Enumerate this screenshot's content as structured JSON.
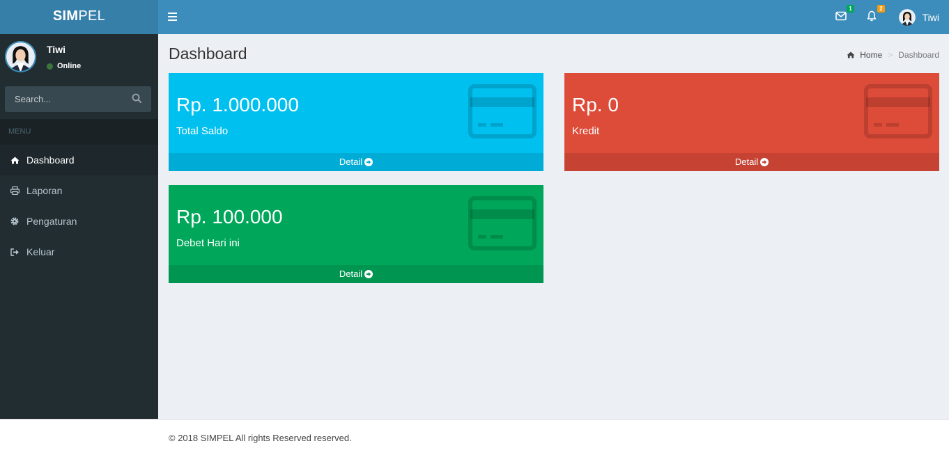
{
  "app": {
    "logo_bold": "SIM",
    "logo_rest": "PEL"
  },
  "header": {
    "messages_count": "1",
    "notifications_count": "2",
    "user_name": "Tiwi"
  },
  "sidebar": {
    "user_name": "Tiwi",
    "status": "Online",
    "search_placeholder": "Search...",
    "menu_header": "MENU",
    "items": [
      {
        "label": "Dashboard",
        "icon": "home-icon",
        "active": true
      },
      {
        "label": "Laporan",
        "icon": "print-icon",
        "active": false
      },
      {
        "label": "Pengaturan",
        "icon": "gear-icon",
        "active": false
      },
      {
        "label": "Keluar",
        "icon": "sign-out-icon",
        "active": false
      }
    ]
  },
  "main": {
    "title": "Dashboard",
    "breadcrumb": {
      "home": "Home",
      "current": "Dashboard"
    },
    "boxes": [
      {
        "amount": "Rp. 1.000.000",
        "label": "Total Saldo",
        "link": "Detail",
        "color": "#00c0ef"
      },
      {
        "amount": "Rp. 0",
        "label": "Kredit",
        "link": "Detail",
        "color": "#dd4b39"
      },
      {
        "amount": "Rp. 100.000",
        "label": "Debet Hari ini",
        "link": "Detail",
        "color": "#00a65a"
      }
    ]
  },
  "footer": {
    "text": "© 2018 SIMPEL All rights Reserved reserved."
  },
  "colors": {
    "header": "#3c8dbc",
    "logo_bg": "#367fa9",
    "sidebar": "#222d32",
    "content_bg": "#ecf0f5"
  }
}
